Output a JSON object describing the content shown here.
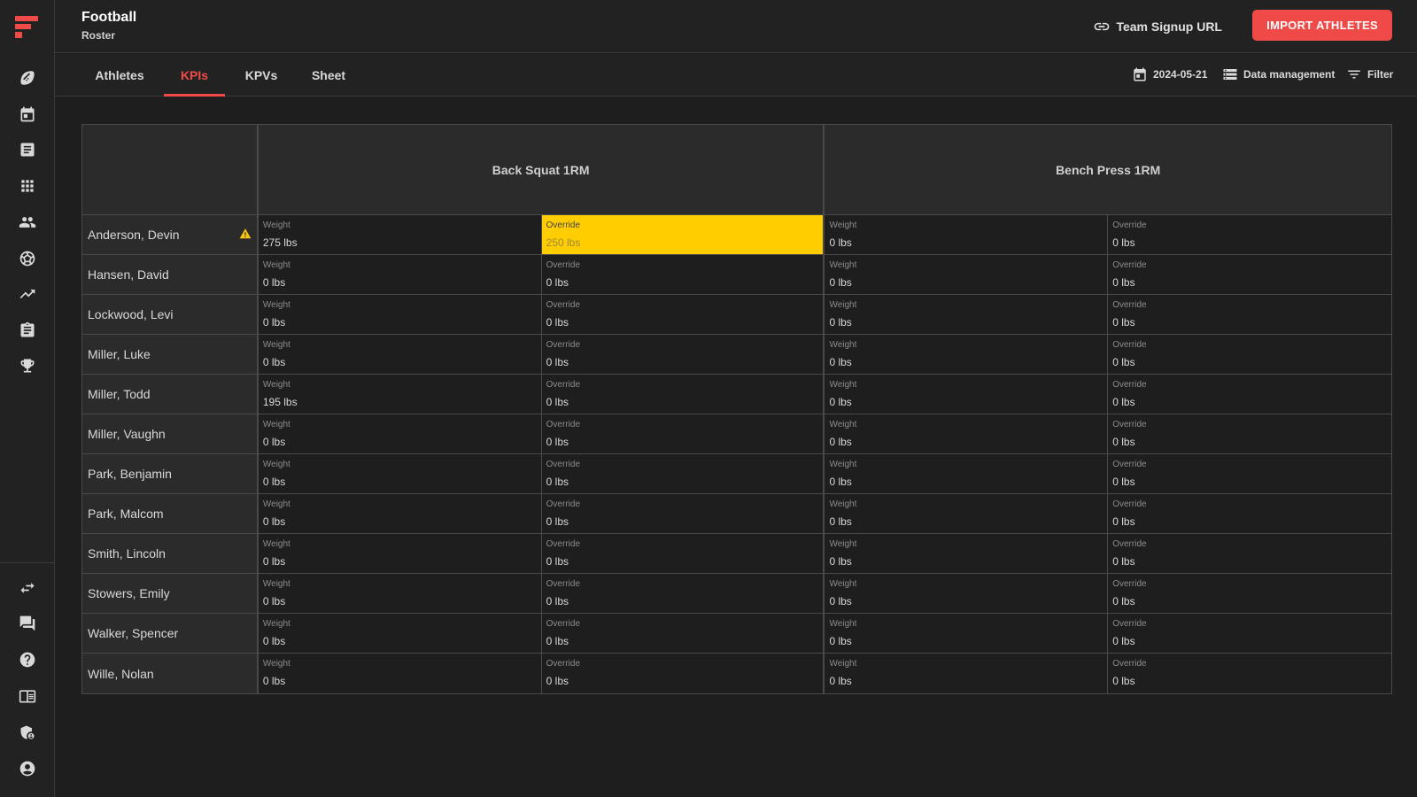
{
  "header": {
    "title": "Football",
    "subtitle": "Roster",
    "signup_label": "Team Signup URL",
    "import_label": "IMPORT ATHLETES"
  },
  "tabs": [
    {
      "label": "Athletes",
      "active": false
    },
    {
      "label": "KPIs",
      "active": true
    },
    {
      "label": "KPVs",
      "active": false
    },
    {
      "label": "Sheet",
      "active": false
    }
  ],
  "toolbar": {
    "date": "2024-05-21",
    "data_management": "Data management",
    "filter": "Filter"
  },
  "sidebar": {
    "top_icons": [
      "football-icon",
      "calendar-icon",
      "notes-icon",
      "apps-grid-icon",
      "people-icon",
      "soccer-ball-icon",
      "trending-icon",
      "clipboard-icon",
      "trophy-icon"
    ],
    "bottom_icons": [
      "swap-icon",
      "chat-icon",
      "help-icon",
      "library-icon",
      "admin-shield-icon",
      "account-icon"
    ]
  },
  "colors": {
    "accent": "#f04a48",
    "highlight": "#ffcd00",
    "warning": "#f5c518"
  },
  "table": {
    "metrics": [
      "Back Squat 1RM",
      "Bench Press 1RM"
    ],
    "weight_label": "Weight",
    "override_label": "Override",
    "rows": [
      {
        "name": "Anderson, Devin",
        "warning": true,
        "values": [
          "275 lbs",
          "250 lbs",
          "0 lbs",
          "0 lbs"
        ]
      },
      {
        "name": "Hansen, David",
        "values": [
          "0 lbs",
          "0 lbs",
          "0 lbs",
          "0 lbs"
        ]
      },
      {
        "name": "Lockwood, Levi",
        "values": [
          "0 lbs",
          "0 lbs",
          "0 lbs",
          "0 lbs"
        ]
      },
      {
        "name": "Miller, Luke",
        "values": [
          "0 lbs",
          "0 lbs",
          "0 lbs",
          "0 lbs"
        ]
      },
      {
        "name": "Miller, Todd",
        "values": [
          "195 lbs",
          "0 lbs",
          "0 lbs",
          "0 lbs"
        ]
      },
      {
        "name": "Miller, Vaughn",
        "values": [
          "0 lbs",
          "0 lbs",
          "0 lbs",
          "0 lbs"
        ]
      },
      {
        "name": "Park, Benjamin",
        "values": [
          "0 lbs",
          "0 lbs",
          "0 lbs",
          "0 lbs"
        ]
      },
      {
        "name": "Park, Malcom",
        "values": [
          "0 lbs",
          "0 lbs",
          "0 lbs",
          "0 lbs"
        ]
      },
      {
        "name": "Smith, Lincoln",
        "values": [
          "0 lbs",
          "0 lbs",
          "0 lbs",
          "0 lbs"
        ]
      },
      {
        "name": "Stowers, Emily",
        "values": [
          "0 lbs",
          "0 lbs",
          "0 lbs",
          "0 lbs"
        ]
      },
      {
        "name": "Walker, Spencer",
        "values": [
          "0 lbs",
          "0 lbs",
          "0 lbs",
          "0 lbs"
        ]
      },
      {
        "name": "Wille, Nolan",
        "values": [
          "0 lbs",
          "0 lbs",
          "0 lbs",
          "0 lbs"
        ]
      }
    ]
  }
}
